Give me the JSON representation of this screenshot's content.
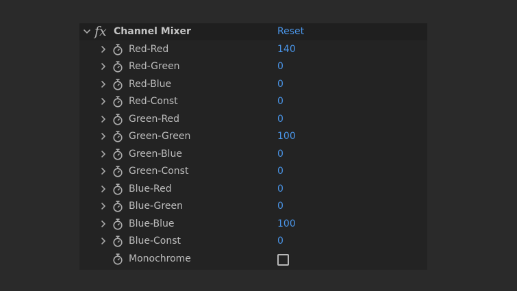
{
  "effect": {
    "name": "Channel Mixer",
    "fx_label": "fx",
    "reset_label": "Reset"
  },
  "params": [
    {
      "label": "Red-Red",
      "value": "140"
    },
    {
      "label": "Red-Green",
      "value": "0"
    },
    {
      "label": "Red-Blue",
      "value": "0"
    },
    {
      "label": "Red-Const",
      "value": "0"
    },
    {
      "label": "Green-Red",
      "value": "0"
    },
    {
      "label": "Green-Green",
      "value": "100"
    },
    {
      "label": "Green-Blue",
      "value": "0"
    },
    {
      "label": "Green-Const",
      "value": "0"
    },
    {
      "label": "Blue-Red",
      "value": "0"
    },
    {
      "label": "Blue-Green",
      "value": "0"
    },
    {
      "label": "Blue-Blue",
      "value": "100"
    },
    {
      "label": "Blue-Const",
      "value": "0"
    }
  ],
  "monochrome": {
    "label": "Monochrome",
    "checked": false
  },
  "colors": {
    "value_blue": "#4a95e8",
    "label_gray": "#bdbdbd",
    "panel_bg": "#232323",
    "page_bg": "#2a2a2a"
  },
  "icons": {
    "expand": "chevron-down-icon",
    "collapse": "chevron-right-icon",
    "stopwatch": "stopwatch-icon",
    "fx": "fx-icon"
  }
}
